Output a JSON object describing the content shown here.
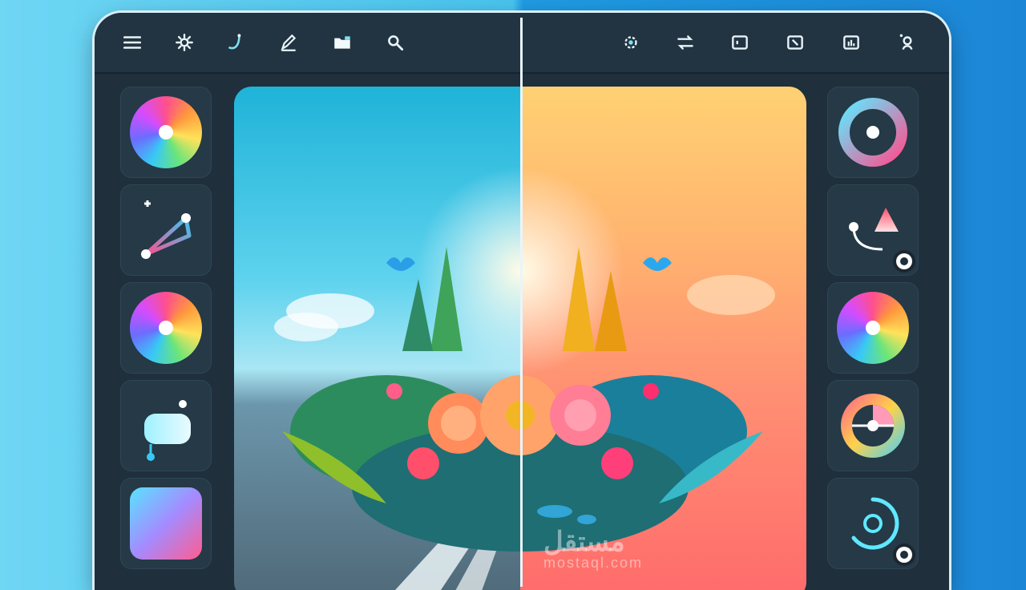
{
  "toolbar": {
    "left_icons": [
      "menu-icon",
      "settings-icon",
      "curve-icon",
      "pen-icon",
      "folder-icon",
      "search-icon"
    ],
    "right_icons": [
      "filter-gear-icon",
      "swap-arrows-icon",
      "crop-icon",
      "rotate-icon",
      "histogram-icon",
      "user-icon"
    ]
  },
  "left_panel": {
    "tools": [
      "color-wheel-icon",
      "gradient-line-icon",
      "color-circle-icon",
      "shape-blob-icon",
      "gradient-square-icon"
    ]
  },
  "right_panel": {
    "tools": [
      "ring-icon",
      "curve-node-icon",
      "color-circle-icon",
      "split-wheel-icon",
      "spiral-icon"
    ]
  },
  "watermark": {
    "text": "مستقل",
    "subtext": "mostaql.com"
  },
  "colors": {
    "device": "#1f2f3c",
    "accent_cyan": "#38c9f5",
    "accent_pink": "#ff4f8e",
    "warm": "#ff8f73"
  }
}
